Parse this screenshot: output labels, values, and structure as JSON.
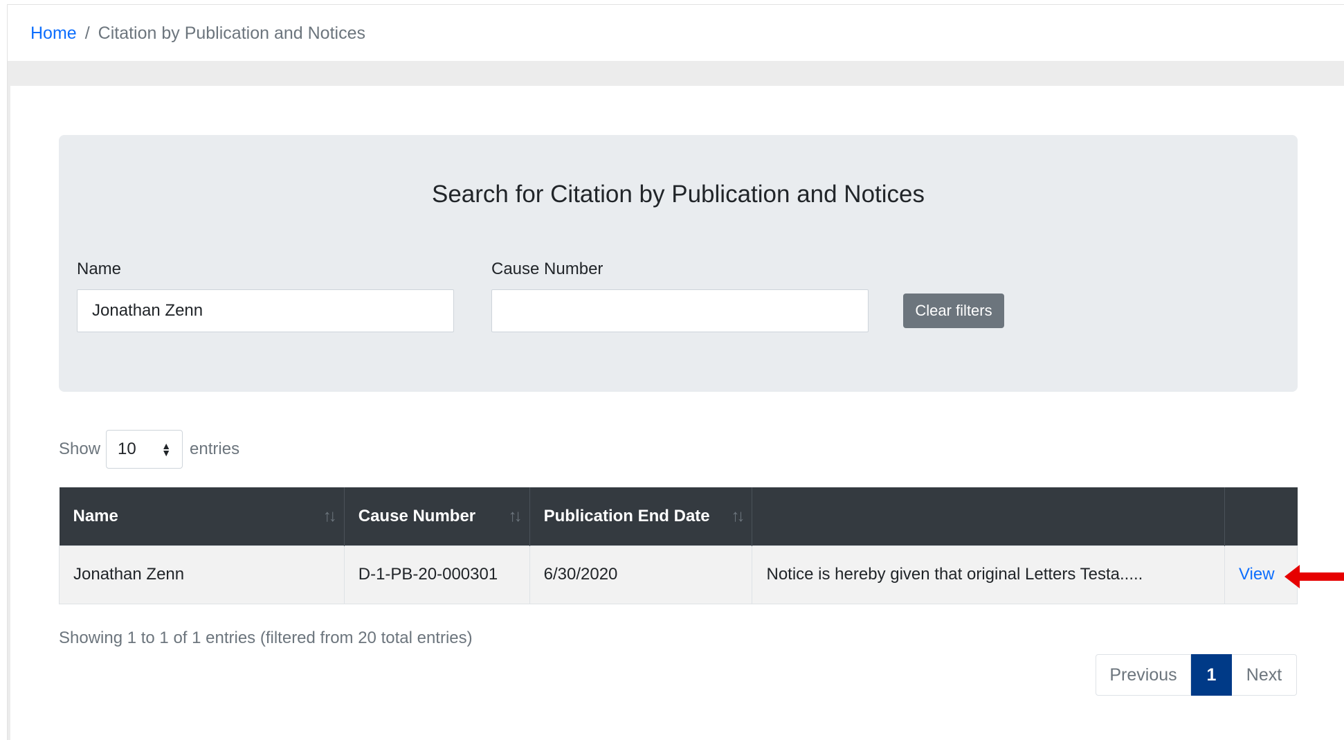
{
  "breadcrumb": {
    "home": "Home",
    "separator": "/",
    "current": "Citation by Publication and Notices"
  },
  "search": {
    "title": "Search for Citation by Publication and Notices",
    "name_label": "Name",
    "name_value": "Jonathan Zenn",
    "cause_label": "Cause Number",
    "cause_value": "",
    "clear_label": "Clear filters"
  },
  "length": {
    "show": "Show",
    "selected": "10",
    "entries": "entries"
  },
  "table": {
    "headers": [
      "Name",
      "Cause Number",
      "Publication End Date",
      "",
      ""
    ],
    "rows": [
      {
        "name": "Jonathan Zenn",
        "cause": "D-1-PB-20-000301",
        "end_date": "6/30/2020",
        "notice": "Notice is hereby given that original Letters Testa.....",
        "action": "View"
      }
    ]
  },
  "info": "Showing 1 to 1 of 1 entries (filtered from 20 total entries)",
  "pagination": {
    "previous": "Previous",
    "current_page": "1",
    "next": "Next"
  },
  "colors": {
    "header_bg": "#343a40",
    "link": "#0d6efd",
    "active_page": "#003a87",
    "annotation_arrow": "#e60000"
  },
  "icons": {
    "sort": "sort-arrows-icon",
    "select": "updown-caret-icon",
    "annotation": "red-arrow-left-icon"
  }
}
